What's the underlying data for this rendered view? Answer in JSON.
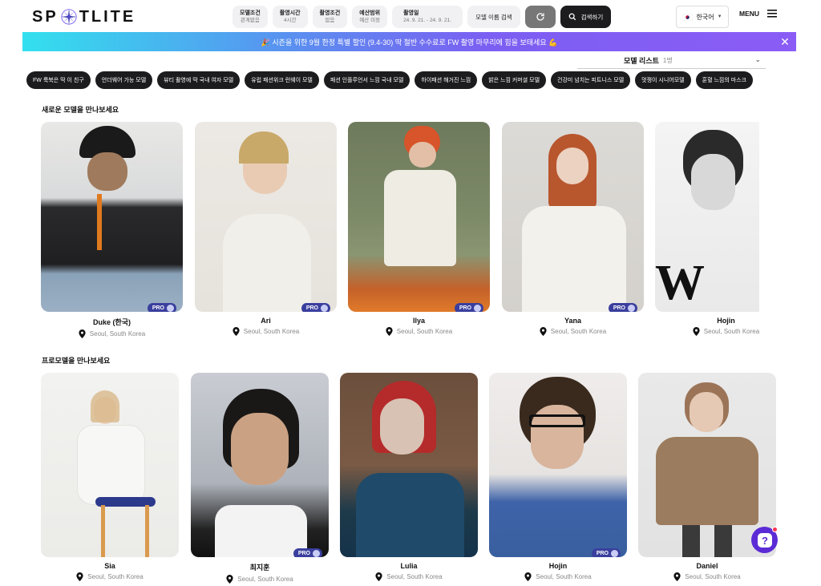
{
  "brand": {
    "logo_left": "SP",
    "logo_right": "TLITE"
  },
  "filters": [
    {
      "title": "모델조건",
      "value": "관계없음"
    },
    {
      "title": "촬영시간",
      "value": "4시간"
    },
    {
      "title": "촬영조건",
      "value": "없음"
    },
    {
      "title": "예산범위",
      "value": "예산 미정"
    },
    {
      "title": "촬영일",
      "value": "24. 9. 21. - 24. 9. 21."
    }
  ],
  "search": {
    "name_label": "모델 이름 검색",
    "search_label": "검색하기"
  },
  "language": {
    "label": "한국어"
  },
  "menu": {
    "label": "MENU"
  },
  "banner": {
    "text": "🎉 시즌을 위한 9월 한정 특별 할인 (9.4-30) 딱 절반 수수료로 FW 촬영 마무리에 힘을 보태세요 💪"
  },
  "model_list": {
    "label": "모델 리스트",
    "count": "1명"
  },
  "tags": [
    "FW 룩북은 딱 이 친구",
    "언더웨어 가능 모델",
    "뷰티 촬영에 딱 국내 여자 모델",
    "유럽 패션위크 런웨이 모델",
    "패션 인플루언서 느낌 국내 모델",
    "하이패션 해거진 느낌",
    "밝은 느낌 커머셜 모델",
    "건강미 넘치는 피트니스 모델",
    "멋쟁이 시니어모델",
    "훈혈 느낌의 마스크"
  ],
  "sections": {
    "new_title": "새로운 모델을 만나보세요",
    "pro_title": "프로모델을 만나보세요"
  },
  "pro_badge": "PRO",
  "new_models": [
    {
      "name": "Duke (한국)",
      "location": "Seoul, South Korea",
      "pro": true
    },
    {
      "name": "Ari",
      "location": "Seoul, South Korea",
      "pro": true
    },
    {
      "name": "Ilya",
      "location": "Seoul, South Korea",
      "pro": true
    },
    {
      "name": "Yana",
      "location": "Seoul, South Korea",
      "pro": true
    },
    {
      "name": "Hojin",
      "location": "Seoul, South Korea",
      "pro": false
    }
  ],
  "pro_models": [
    {
      "name": "Sia",
      "location": "Seoul, South Korea",
      "pro": false
    },
    {
      "name": "최지훈",
      "location": "Seoul, South Korea",
      "pro": true
    },
    {
      "name": "Lulia",
      "location": "Seoul, South Korea",
      "pro": false
    },
    {
      "name": "Hojin",
      "location": "Seoul, South Korea",
      "pro": true
    },
    {
      "name": "Daniel",
      "location": "Seoul, South Korea",
      "pro": false
    }
  ],
  "help": {
    "label": "?"
  },
  "colors": {
    "accent": "#5b2bd6",
    "pro_badge": "#3a3f9e",
    "dark_chip": "#1c1c1e"
  }
}
